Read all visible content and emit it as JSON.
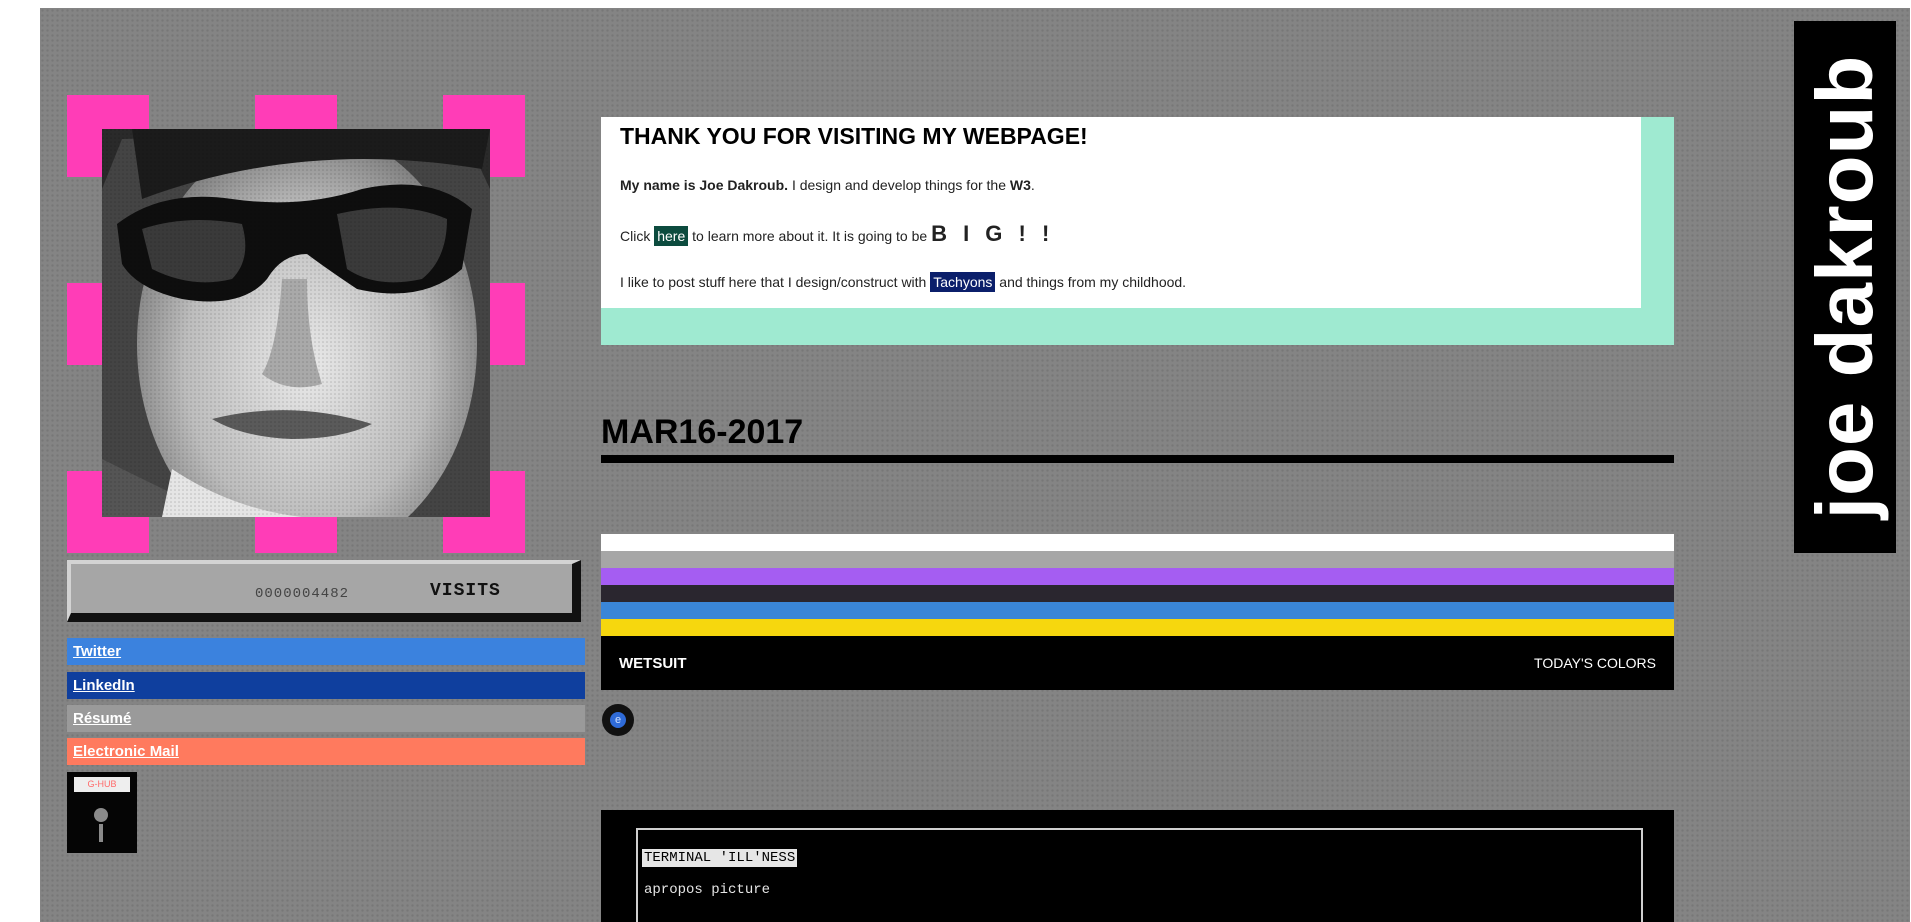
{
  "profile": {
    "counter_value": "0000004482",
    "counter_label": "VISITS"
  },
  "links": [
    {
      "label": "Twitter",
      "color": "#3b82de"
    },
    {
      "label": "LinkedIn",
      "color": "#0f3f9e"
    },
    {
      "label": "Résumé",
      "color": "#9a9a9a"
    },
    {
      "label": "Electronic Mail",
      "color": "#ff7a5e"
    }
  ],
  "floppy": {
    "label": "G-HUB"
  },
  "welcome": {
    "title": "THANK YOU FOR VISITING MY WEBPAGE!",
    "p1_bold": "My name is Joe Dakroub.",
    "p1_text": " I design and develop things for the ",
    "p1_end": "W3",
    "p1_period": ".",
    "p2_pre": "Click ",
    "p2_link": "here",
    "p2_mid": " to learn more about it. It is going to be ",
    "p2_big": "B I G ! !",
    "p3_pre": "I like to post stuff here that I design/construct with ",
    "p3_link": "Tachyons",
    "p3_post": " and things from my childhood."
  },
  "post": {
    "date": "MAR16-2017"
  },
  "palette": {
    "name": "WETSUIT",
    "tag": "TODAY'S COLORS",
    "colors": [
      "#ffffff",
      "#a6a6a6",
      "#a55df2",
      "#2a262f",
      "#3a86d8",
      "#f6d70e"
    ]
  },
  "icon_badge": {
    "glyph": "e",
    "icon": "circle-badge-icon"
  },
  "terminal": {
    "title": "TERMINAL 'ILL'NESS",
    "text": "apropos picture"
  },
  "sidebar_title": "joe dakroub"
}
